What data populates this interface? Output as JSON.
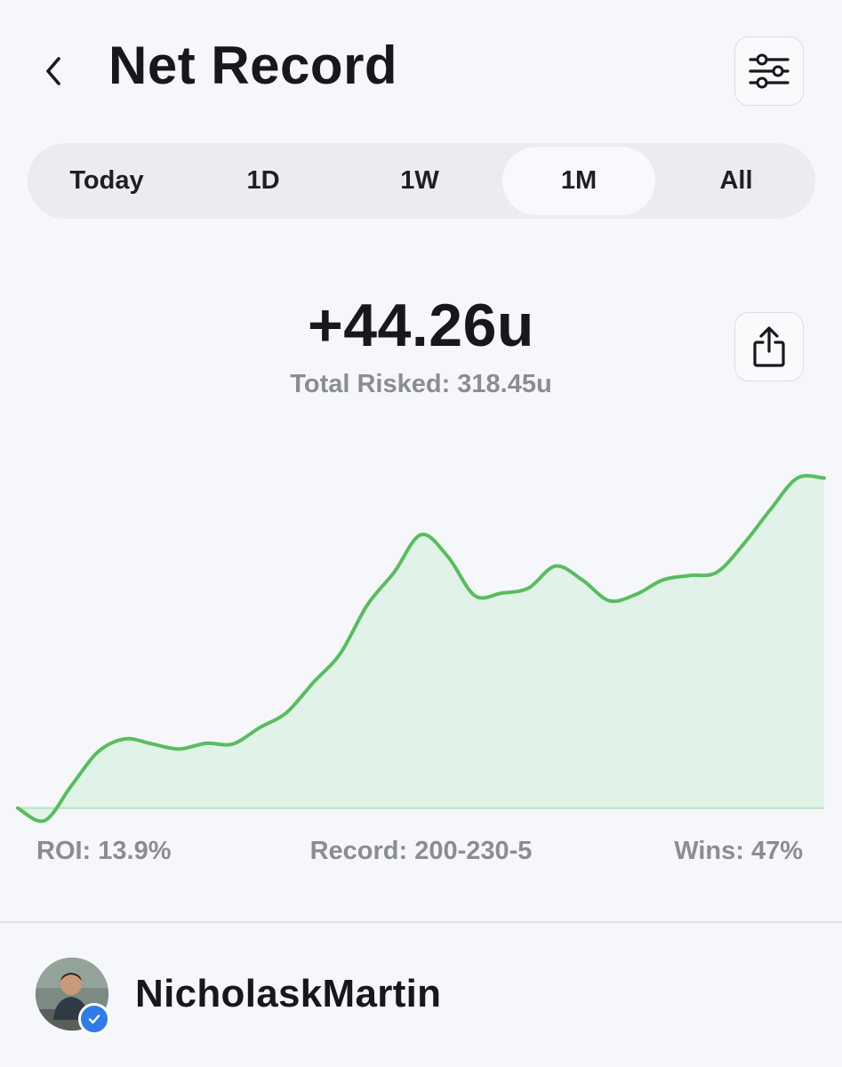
{
  "header": {
    "title": "Net Record",
    "back_icon": "chevron-left-icon",
    "filter_icon": "sliders-icon"
  },
  "tabs": [
    {
      "label": "Today",
      "active": false
    },
    {
      "label": "1D",
      "active": false
    },
    {
      "label": "1W",
      "active": false
    },
    {
      "label": "1M",
      "active": true
    },
    {
      "label": "All",
      "active": false
    }
  ],
  "summary": {
    "net_units": "+44.26u",
    "total_risked": "Total Risked: 318.45u",
    "share_icon": "share-icon"
  },
  "chart_data": {
    "type": "area",
    "x": [
      0,
      1,
      2,
      3,
      4,
      5,
      6,
      7,
      8,
      9,
      10,
      11,
      12,
      13,
      14,
      15,
      16,
      17,
      18,
      19,
      20,
      21,
      22,
      23,
      24,
      25,
      26,
      27,
      28,
      29,
      30
    ],
    "y": [
      0,
      -2,
      3.6,
      9,
      11,
      10.2,
      9.4,
      10.3,
      10.2,
      12.8,
      15.2,
      20,
      24.6,
      32.3,
      37.5,
      43.5,
      40,
      33.8,
      34.2,
      35,
      38.5,
      36.3,
      33,
      34,
      36.3,
      37,
      37.5,
      42,
      47.5,
      52.5,
      52.5
    ],
    "xlabel": "",
    "ylabel": "",
    "ylim": [
      -3,
      55
    ],
    "grid": false,
    "baseline": 0,
    "colors": {
      "line": "#58bd5f",
      "fill": "#e1f3e8",
      "baseline": "#bfe6cb"
    }
  },
  "stats": {
    "roi": "ROI: 13.9%",
    "record": "Record: 200-230-5",
    "wins": "Wins: 47%"
  },
  "user": {
    "username": "NicholaskMartin",
    "verified": true,
    "verified_icon": "checkmark-icon",
    "accent": "#2f7be8"
  }
}
